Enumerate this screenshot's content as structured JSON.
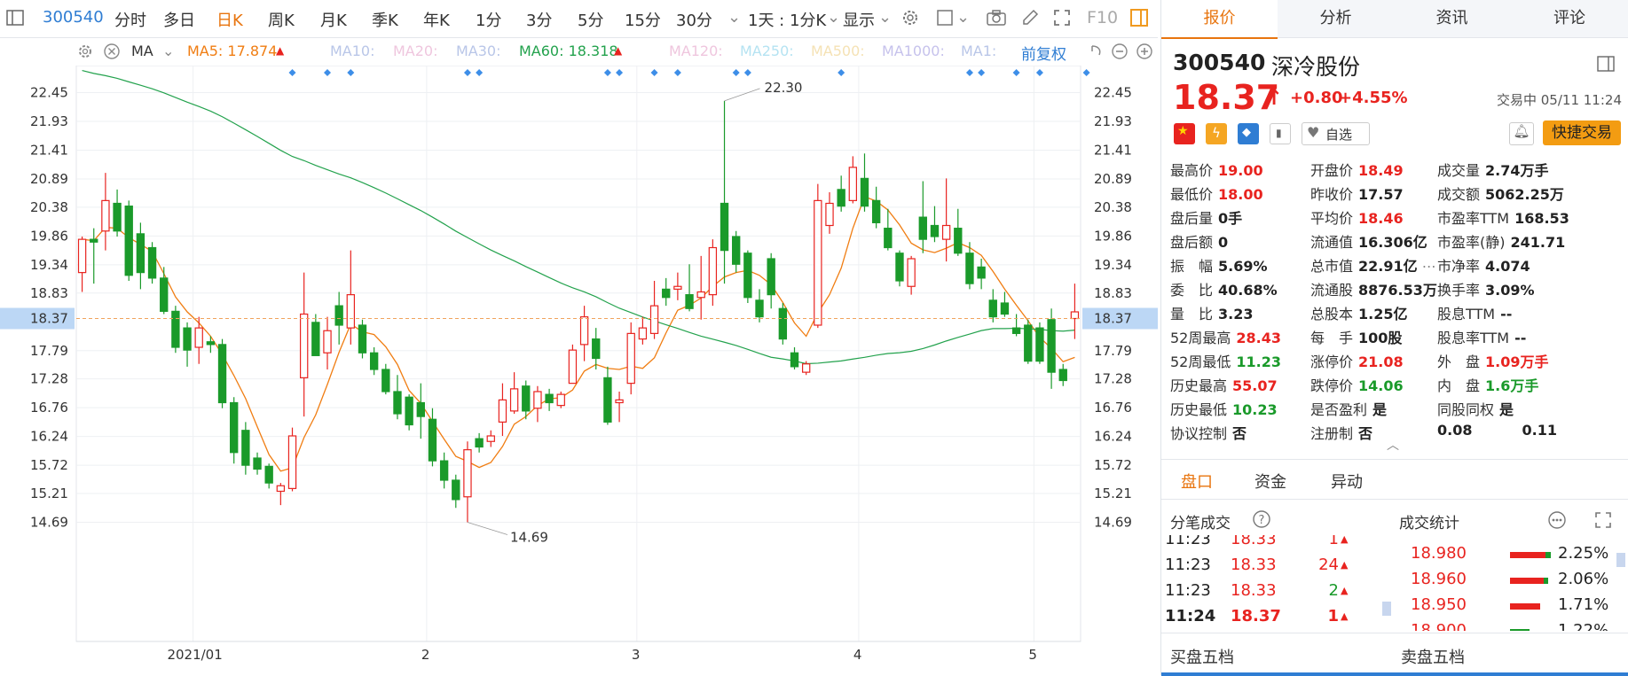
{
  "toolbar": {
    "stock_code": "300540",
    "periods": [
      "分时",
      "多日",
      "日K",
      "周K",
      "月K",
      "季K",
      "年K",
      "1分",
      "3分",
      "5分",
      "15分",
      "30分"
    ],
    "active_period": "日K",
    "interval_select": "1天 : 1分K",
    "display_select": "显示",
    "f10": "F10"
  },
  "ma_bar": {
    "indicator": "MA",
    "ma5": "MA5: 17.874",
    "ma10": "MA10:",
    "ma20": "MA20:",
    "ma30": "MA30:",
    "ma60": "MA60: 18.318",
    "ma120": "MA120:",
    "ma250": "MA250:",
    "ma500": "MA500:",
    "ma1000": "MA1000:",
    "ma1x": "MA1:",
    "adjust": "前复权",
    "colors": {
      "ma5": "#f07d12",
      "ma60": "#23a24d",
      "faded": "#b9c6e8"
    }
  },
  "chart_data": {
    "type": "candlestick",
    "y_ticks": [
      "22.45",
      "21.93",
      "21.41",
      "20.89",
      "20.38",
      "19.86",
      "19.34",
      "18.83",
      "18.37",
      "17.79",
      "17.28",
      "16.76",
      "16.24",
      "15.72",
      "15.21",
      "14.69"
    ],
    "x_ticks": [
      "2021/01",
      "2",
      "3",
      "4",
      "5"
    ],
    "current_price_line": "18.37",
    "max_label": "22.30",
    "min_label": "14.69",
    "up_color": "#e8231f",
    "down_color": "#1a9a2a",
    "candles": [
      [
        19.2,
        19.85,
        18.85,
        19.8
      ],
      [
        19.8,
        20.0,
        19.0,
        19.75
      ],
      [
        19.95,
        21.0,
        19.6,
        20.5
      ],
      [
        20.45,
        20.7,
        19.85,
        19.95
      ],
      [
        20.4,
        20.5,
        19.05,
        19.15
      ],
      [
        19.9,
        20.1,
        18.9,
        19.2
      ],
      [
        19.65,
        19.75,
        19.0,
        19.1
      ],
      [
        19.1,
        19.3,
        18.45,
        18.5
      ],
      [
        18.5,
        18.6,
        17.75,
        17.85
      ],
      [
        18.2,
        18.3,
        17.5,
        17.8
      ],
      [
        17.85,
        18.4,
        17.55,
        18.2
      ],
      [
        17.95,
        18.05,
        17.75,
        17.9
      ],
      [
        17.9,
        18.0,
        16.75,
        16.85
      ],
      [
        16.85,
        16.95,
        15.75,
        15.95
      ],
      [
        16.35,
        16.5,
        15.55,
        15.72
      ],
      [
        15.85,
        15.95,
        15.55,
        15.65
      ],
      [
        15.7,
        15.75,
        15.3,
        15.4
      ],
      [
        15.25,
        15.4,
        15.0,
        15.35
      ],
      [
        15.3,
        16.4,
        15.25,
        16.25
      ],
      [
        17.3,
        19.2,
        16.6,
        18.45
      ],
      [
        18.3,
        18.45,
        17.7,
        17.7
      ],
      [
        17.75,
        18.4,
        17.45,
        18.15
      ],
      [
        18.6,
        18.85,
        17.9,
        18.25
      ],
      [
        18.2,
        19.6,
        17.9,
        18.8
      ],
      [
        18.25,
        18.35,
        17.65,
        17.75
      ],
      [
        17.75,
        17.85,
        17.35,
        17.45
      ],
      [
        17.45,
        17.55,
        17.0,
        17.05
      ],
      [
        17.05,
        17.35,
        16.55,
        16.65
      ],
      [
        16.95,
        17.0,
        16.35,
        16.45
      ],
      [
        16.85,
        17.2,
        16.2,
        16.6
      ],
      [
        16.55,
        16.75,
        15.7,
        15.8
      ],
      [
        15.8,
        15.95,
        15.3,
        15.45
      ],
      [
        15.45,
        15.55,
        14.95,
        15.1
      ],
      [
        15.15,
        16.15,
        14.69,
        16.0
      ],
      [
        16.2,
        16.3,
        15.95,
        16.05
      ],
      [
        16.15,
        16.35,
        16.05,
        16.25
      ],
      [
        16.5,
        17.2,
        16.25,
        16.9
      ],
      [
        16.7,
        17.4,
        16.65,
        17.1
      ],
      [
        17.15,
        17.25,
        16.55,
        16.7
      ],
      [
        16.75,
        17.15,
        16.5,
        17.05
      ],
      [
        17.0,
        17.1,
        16.7,
        16.85
      ],
      [
        16.8,
        17.05,
        16.75,
        17.0
      ],
      [
        17.2,
        17.9,
        17.2,
        17.8
      ],
      [
        17.9,
        18.6,
        17.6,
        18.4
      ],
      [
        18.0,
        18.2,
        17.45,
        17.65
      ],
      [
        17.3,
        17.5,
        16.45,
        16.5
      ],
      [
        16.85,
        17.05,
        16.5,
        16.9
      ],
      [
        17.2,
        18.3,
        17.0,
        18.1
      ],
      [
        18.0,
        18.4,
        17.9,
        18.2
      ],
      [
        18.1,
        19.05,
        18.0,
        18.6
      ],
      [
        18.9,
        19.1,
        18.6,
        18.75
      ],
      [
        18.9,
        19.2,
        18.7,
        18.95
      ],
      [
        18.8,
        19.35,
        18.5,
        18.55
      ],
      [
        18.75,
        19.5,
        18.35,
        18.85
      ],
      [
        18.8,
        19.8,
        18.6,
        19.65
      ],
      [
        20.45,
        22.3,
        19.0,
        19.6
      ],
      [
        19.85,
        19.95,
        19.2,
        19.35
      ],
      [
        19.55,
        19.6,
        18.65,
        18.75
      ],
      [
        18.7,
        18.9,
        18.3,
        18.4
      ],
      [
        19.45,
        19.55,
        18.55,
        18.8
      ],
      [
        18.55,
        18.65,
        17.9,
        18.0
      ],
      [
        17.75,
        17.85,
        17.45,
        17.5
      ],
      [
        17.4,
        17.6,
        17.35,
        17.55
      ],
      [
        18.25,
        20.8,
        18.2,
        20.5
      ],
      [
        20.05,
        20.65,
        19.9,
        20.45
      ],
      [
        20.7,
        20.95,
        20.3,
        20.4
      ],
      [
        20.5,
        21.3,
        20.45,
        21.1
      ],
      [
        20.9,
        21.35,
        20.3,
        20.4
      ],
      [
        20.5,
        20.75,
        20.0,
        20.1
      ],
      [
        20.0,
        20.35,
        19.6,
        19.65
      ],
      [
        19.55,
        19.6,
        18.95,
        19.05
      ],
      [
        18.95,
        19.5,
        18.8,
        19.45
      ],
      [
        20.2,
        20.85,
        19.55,
        19.8
      ],
      [
        20.05,
        20.4,
        19.75,
        19.85
      ],
      [
        19.8,
        20.9,
        19.4,
        20.05
      ],
      [
        20.0,
        20.35,
        19.5,
        19.55
      ],
      [
        19.55,
        19.75,
        18.9,
        19.0
      ],
      [
        19.3,
        19.45,
        18.9,
        19.1
      ],
      [
        18.7,
        18.9,
        18.3,
        18.4
      ],
      [
        18.65,
        18.85,
        18.4,
        18.45
      ],
      [
        18.2,
        18.45,
        18.05,
        18.1
      ],
      [
        18.25,
        18.35,
        17.55,
        17.6
      ],
      [
        18.2,
        18.3,
        17.55,
        17.6
      ],
      [
        18.35,
        18.55,
        17.1,
        17.4
      ],
      [
        17.45,
        17.55,
        17.15,
        17.25
      ],
      [
        18.37,
        19.0,
        18.0,
        18.49
      ]
    ]
  },
  "right_panel": {
    "tabs": [
      "报价",
      "分析",
      "资讯",
      "评论"
    ],
    "active_tab": "报价",
    "code": "300540",
    "name": "深冷股份",
    "price": "18.37",
    "change": "+0.80",
    "change_pct": "+4.55%",
    "status": "交易中 05/11 11:24",
    "watch_label": "自选",
    "trade_button": "快捷交易",
    "quote": [
      [
        [
          "最高价",
          "19.00",
          "red"
        ],
        [
          "开盘价",
          "18.49",
          "red"
        ],
        [
          "成交量",
          "2.74万手",
          "blk"
        ]
      ],
      [
        [
          "最低价",
          "18.00",
          "red"
        ],
        [
          "昨收价",
          "17.57",
          "blk"
        ],
        [
          "成交额",
          "5062.25万",
          "blk"
        ]
      ],
      [
        [
          "盘后量",
          "0手",
          "blk"
        ],
        [
          "平均价",
          "18.46",
          "red"
        ],
        [
          "市盈率TTM",
          "168.53",
          "blk"
        ]
      ],
      [
        [
          "盘后额",
          "0",
          "blk"
        ],
        [
          "流通值",
          "16.306亿",
          "blk"
        ],
        [
          "市盈率(静)",
          "241.71",
          "blk"
        ]
      ],
      [
        [
          "振　幅",
          "5.69%",
          "blk"
        ],
        [
          "总市值",
          "22.91亿",
          "blk"
        ],
        [
          "市净率",
          "4.074",
          "blk"
        ]
      ],
      [
        [
          "委　比",
          "40.68%",
          "blk"
        ],
        [
          "流通股",
          "8876.53万",
          "blk"
        ],
        [
          "换手率",
          "3.09%",
          "blk"
        ]
      ],
      [
        [
          "量　比",
          "3.23",
          "blk"
        ],
        [
          "总股本",
          "1.25亿",
          "blk"
        ],
        [
          "股息TTM",
          "--",
          "blk"
        ]
      ],
      [
        [
          "52周最高",
          "28.43",
          "red"
        ],
        [
          "每　手",
          "100股",
          "blk"
        ],
        [
          "股息率TTM",
          "--",
          "blk"
        ]
      ],
      [
        [
          "52周最低",
          "11.23",
          "green"
        ],
        [
          "涨停价",
          "21.08",
          "red"
        ],
        [
          "外　盘",
          "1.09万手",
          "red"
        ]
      ],
      [
        [
          "历史最高",
          "55.07",
          "red"
        ],
        [
          "跌停价",
          "14.06",
          "green"
        ],
        [
          "内　盘",
          "1.6万手",
          "green"
        ]
      ],
      [
        [
          "历史最低",
          "10.23",
          "green"
        ],
        [
          "是否盈利",
          "是",
          "blk"
        ],
        [
          "同股同权",
          "是",
          "blk"
        ]
      ],
      [
        [
          "协议控制",
          "否",
          "blk"
        ],
        [
          "注册制",
          "否",
          "blk"
        ],
        [
          "0.08",
          "0.11",
          "blk"
        ]
      ]
    ],
    "sub_tabs": [
      "盘口",
      "资金",
      "异动"
    ],
    "active_sub_tab": "盘口",
    "ticks_title": "分笔成交",
    "ticks": [
      [
        "11:23",
        "18.33",
        "1"
      ],
      [
        "11:23",
        "18.33",
        "24"
      ],
      [
        "11:23",
        "18.33",
        "2"
      ],
      [
        "11:24",
        "18.37",
        "1"
      ]
    ],
    "stats_title": "成交统计",
    "stats": [
      [
        "18.980",
        "2.25%"
      ],
      [
        "18.960",
        "2.06%"
      ],
      [
        "18.950",
        "1.71%"
      ],
      [
        "18.900",
        "1.22%"
      ]
    ],
    "buy5": "买盘五档",
    "sell5": "卖盘五档"
  }
}
